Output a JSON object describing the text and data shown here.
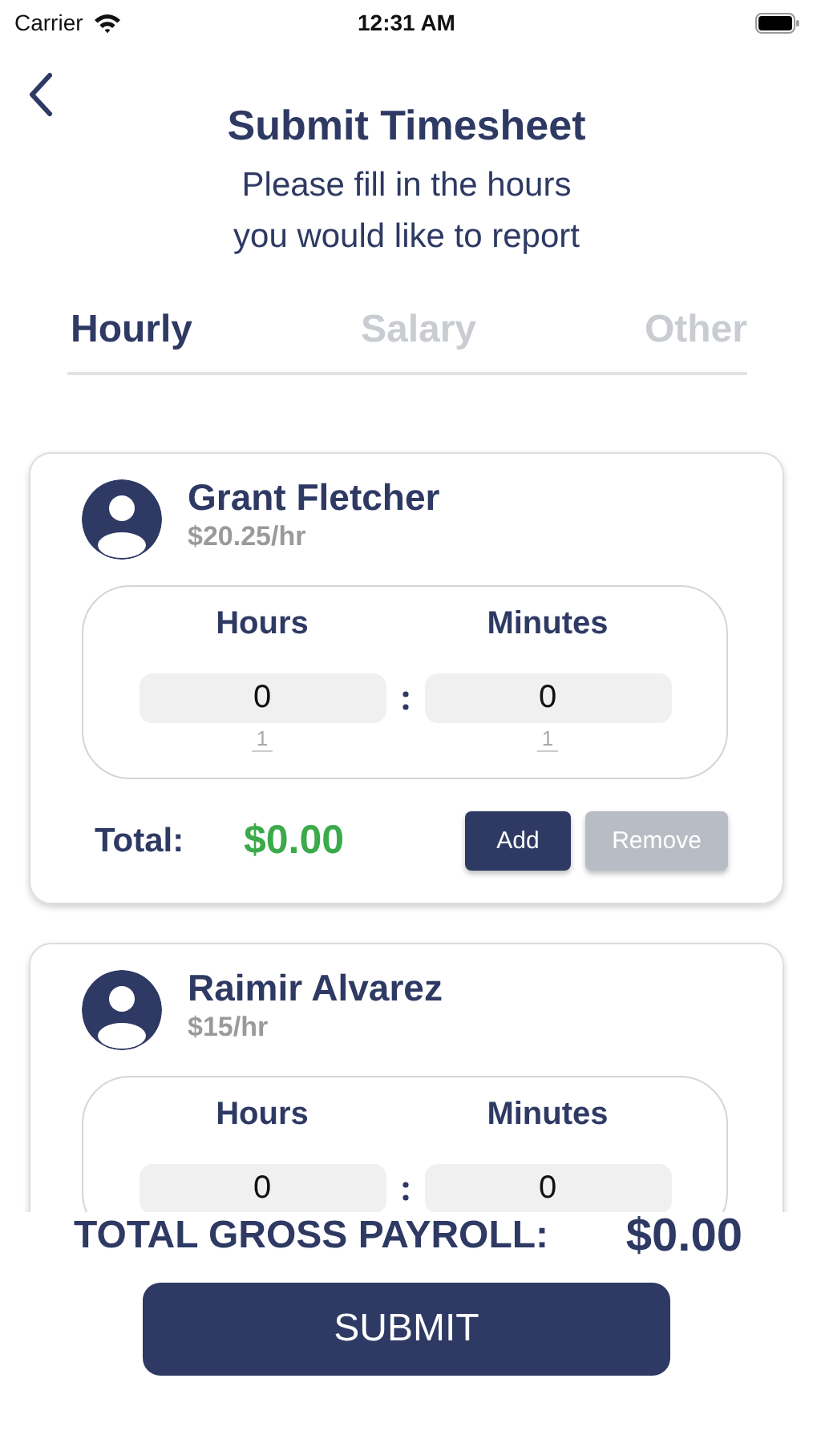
{
  "status_bar": {
    "carrier": "Carrier",
    "time": "12:31 AM"
  },
  "header": {
    "title": "Submit Timesheet",
    "subtitle": [
      "Please fill in the hours",
      "you would like to report"
    ]
  },
  "tabs": [
    {
      "label": "Hourly",
      "selected": true
    },
    {
      "label": "Salary",
      "selected": false
    },
    {
      "label": "Other",
      "selected": false
    }
  ],
  "employees": [
    {
      "name": "Grant Fletcher",
      "rate": "$20.25/hr",
      "hours_label": "Hours",
      "minutes_label": "Minutes",
      "hours": "0",
      "minutes": "0",
      "hours_next": "1",
      "minutes_next": "1",
      "total_label": "Total:",
      "total": "$0.00",
      "add_button": "Add",
      "remove_button": "Remove",
      "remove_disabled": true
    },
    {
      "name": "Raimir Alvarez",
      "rate": "$15/hr",
      "hours_label": "Hours",
      "minutes_label": "Minutes",
      "hours": "0",
      "minutes": "0"
    }
  ],
  "payroll": {
    "label": "TOTAL GROSS PAYROLL:",
    "value": "$0.00"
  },
  "submit_button": "SUBMIT"
}
